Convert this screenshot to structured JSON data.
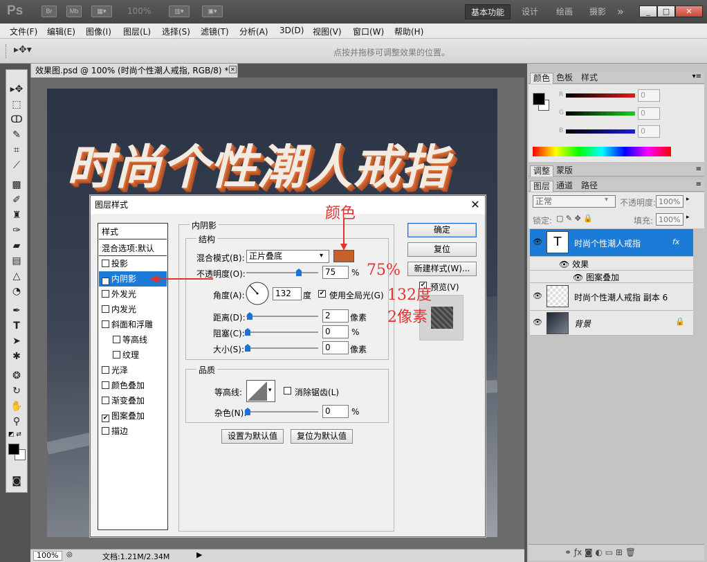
{
  "app": {
    "logo": "Ps",
    "bridge_label": "Br",
    "minibridge_label": "Mb",
    "zoom_display": "100%",
    "workspaces": [
      "基本功能",
      "设计",
      "绘画",
      "摄影"
    ],
    "more_glyph": "»",
    "win_min": "_",
    "win_max": "□",
    "win_close": "✕"
  },
  "menu": [
    "文件(F)",
    "编辑(E)",
    "图像(I)",
    "图层(L)",
    "选择(S)",
    "滤镜(T)",
    "分析(A)",
    "3D(D)",
    "视图(V)",
    "窗口(W)",
    "帮助(H)"
  ],
  "options_hint": "点按并拖移可调整效果的位置。",
  "document": {
    "tab_label": "效果图.psd @ 100% (时尚个性潮人戒指, RGB/8) *",
    "tab_close": "✕",
    "headline": "时尚个性潮人戒指",
    "status_zoom": "100%",
    "status_doc": "文档:1.21M/2.34M"
  },
  "color_panel": {
    "tabs": [
      "颜色",
      "色板",
      "样式"
    ],
    "channels": [
      {
        "label": "R",
        "value": "0",
        "color": "#e21b1b"
      },
      {
        "label": "G",
        "value": "0",
        "color": "#1bd11b"
      },
      {
        "label": "B",
        "value": "0",
        "color": "#1b1be2"
      }
    ]
  },
  "adjust_panel": {
    "tabs": [
      "调整",
      "蒙版"
    ]
  },
  "layers_panel": {
    "tabs": [
      "图层",
      "通道",
      "路径"
    ],
    "blend_mode": "正常",
    "opacity_label": "不透明度:",
    "opacity_value": "100%",
    "lock_label": "锁定:",
    "fill_label": "填充:",
    "fill_value": "100%",
    "layers": [
      {
        "name": "时尚个性潮人戒指",
        "thumb": "T",
        "fx": "fx"
      },
      {
        "name": "效果"
      },
      {
        "name": "图案叠加"
      },
      {
        "name": "时尚个性潮人戒指 副本 6"
      },
      {
        "name": "背景"
      }
    ]
  },
  "dialog": {
    "title": "图层样式",
    "styles_header": "样式",
    "blend_options": "混合选项:默认",
    "style_items": [
      {
        "label": "投影",
        "checked": false
      },
      {
        "label": "内阴影",
        "checked": true
      },
      {
        "label": "外发光",
        "checked": false
      },
      {
        "label": "内发光",
        "checked": false
      },
      {
        "label": "斜面和浮雕",
        "checked": false
      },
      {
        "label": "等高线",
        "checked": false
      },
      {
        "label": "纹理",
        "checked": false
      },
      {
        "label": "光泽",
        "checked": false
      },
      {
        "label": "颜色叠加",
        "checked": false
      },
      {
        "label": "渐变叠加",
        "checked": false
      },
      {
        "label": "图案叠加",
        "checked": true
      },
      {
        "label": "描边",
        "checked": false
      }
    ],
    "section_title": "内阴影",
    "structure_title": "结构",
    "blend_mode_label": "混合模式(B):",
    "blend_mode_value": "正片叠底",
    "shadow_color": "#c8602a",
    "opacity_label": "不透明度(O):",
    "opacity_value": "75",
    "opacity_unit": "%",
    "angle_label": "角度(A):",
    "angle_value": "132",
    "angle_unit": "度",
    "global_light_label": "使用全局光(G)",
    "distance_label": "距离(D):",
    "distance_value": "2",
    "distance_unit": "像素",
    "choke_label": "阻塞(C):",
    "choke_value": "0",
    "choke_unit": "%",
    "size_label": "大小(S):",
    "size_value": "0",
    "size_unit": "像素",
    "quality_title": "品质",
    "contour_label": "等高线:",
    "antialias_label": "消除锯齿(L)",
    "noise_label": "杂色(N):",
    "noise_value": "0",
    "noise_unit": "%",
    "set_default": "设置为默认值",
    "reset_default": "复位为默认值",
    "ok": "确定",
    "reset": "复位",
    "new_style": "新建样式(W)...",
    "preview_label": "预览(V)",
    "close_glyph": "✕"
  },
  "annotations": {
    "color_note": "颜色",
    "opacity_note": "75%",
    "angle_note": "132度",
    "distance_note": "2像素"
  }
}
